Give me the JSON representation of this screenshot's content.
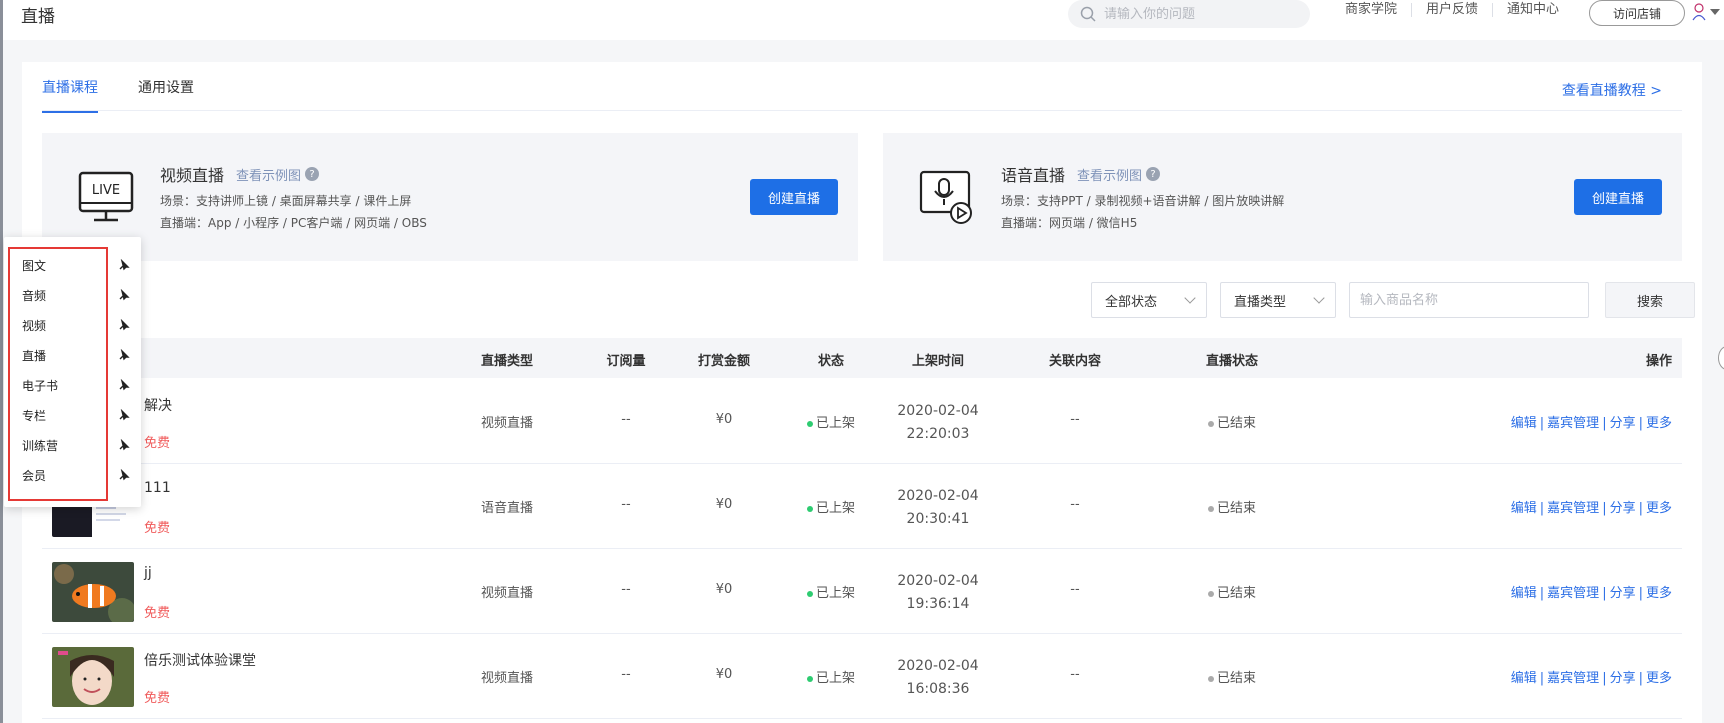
{
  "topbar": {
    "title": "直播",
    "search_placeholder": "请输入你的问题",
    "links": [
      "商家学院",
      "用户反馈",
      "通知中心"
    ],
    "visit_store": "访问店铺"
  },
  "tabs": [
    {
      "label": "直播课程",
      "active": true
    },
    {
      "label": "通用设置",
      "active": false
    }
  ],
  "tutorial_link": "查看直播教程 >",
  "panels": [
    {
      "icon_text": "LIVE",
      "name": "视频直播",
      "example_link": "查看示例图",
      "scene": "场景：支持讲师上镜 / 桌面屏幕共享 / 课件上屏",
      "client": "直播端：App / 小程序 / PC客户端 / 网页端 / OBS",
      "button": "创建直播"
    },
    {
      "name": "语音直播",
      "example_link": "查看示例图",
      "scene": "场景：支持PPT / 录制视频+语音讲解 / 图片放映讲解",
      "client": "直播端：网页端 / 微信H5",
      "button": "创建直播"
    }
  ],
  "filters": {
    "status_select": "全部状态",
    "type_select": "直播类型",
    "goods_placeholder": "输入商品名称",
    "search_button": "搜索"
  },
  "table": {
    "headers": [
      "直播类型",
      "订阅量",
      "打赏金额",
      "状态",
      "上架时间",
      "关联内容",
      "直播状态",
      "操作"
    ],
    "rows": [
      {
        "name": "解决",
        "price": "免费",
        "type": "视频直播",
        "subs": "--",
        "reward": "¥0",
        "status": "已上架",
        "date": "2020-02-04",
        "time": "22:20:03",
        "related": "--",
        "live_status": "已结束"
      },
      {
        "name": "111",
        "price": "免费",
        "type": "语音直播",
        "subs": "--",
        "reward": "¥0",
        "status": "已上架",
        "date": "2020-02-04",
        "time": "20:30:41",
        "related": "--",
        "live_status": "已结束"
      },
      {
        "name": "jj",
        "price": "免费",
        "type": "视频直播",
        "subs": "--",
        "reward": "¥0",
        "status": "已上架",
        "date": "2020-02-04",
        "time": "19:36:14",
        "related": "--",
        "live_status": "已结束"
      },
      {
        "name": "倍乐测试体验课堂",
        "price": "免费",
        "type": "视频直播",
        "subs": "--",
        "reward": "¥0",
        "status": "已上架",
        "date": "2020-02-04",
        "time": "16:08:36",
        "related": "--",
        "live_status": "已结束"
      }
    ],
    "ops": {
      "edit": "编辑",
      "guest": "嘉宾管理",
      "share": "分享",
      "more": "更多"
    }
  },
  "popup_menu": [
    "图文",
    "音频",
    "视频",
    "直播",
    "电子书",
    "专栏",
    "训练营",
    "会员"
  ],
  "colors": {
    "primary": "#1e6fe6",
    "link": "#2d6fe6",
    "price": "#f05b5b",
    "on_shelf_dot": "#2ecc71",
    "ended_dot": "#aaaaaa",
    "highlight_box": "#e53935"
  }
}
